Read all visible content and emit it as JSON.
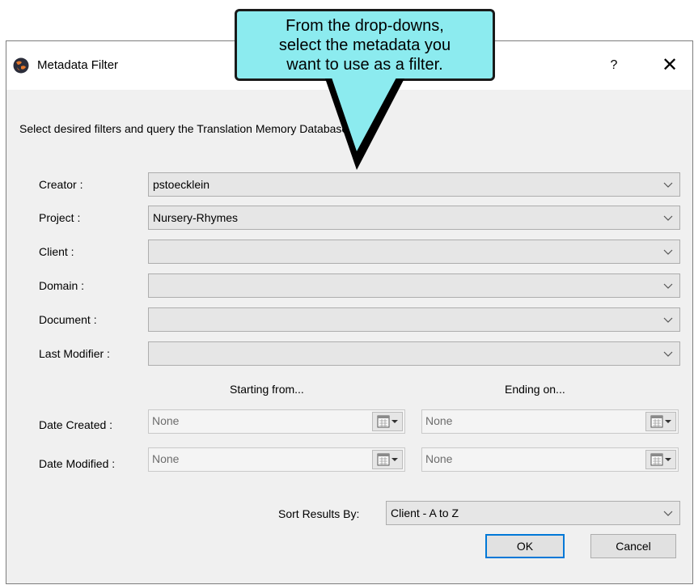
{
  "window": {
    "title": "Metadata Filter",
    "help": "?",
    "close": "✕"
  },
  "callout": {
    "text": "From the drop-downs,\nselect the metadata you\nwant to use as a filter."
  },
  "intro": "Select desired filters and query the Translation Memory Database...",
  "filters": [
    {
      "label": "Creator :",
      "value": "pstoecklein"
    },
    {
      "label": "Project :",
      "value": "Nursery-Rhymes"
    },
    {
      "label": "Client :",
      "value": ""
    },
    {
      "label": "Domain :",
      "value": ""
    },
    {
      "label": "Document :",
      "value": ""
    },
    {
      "label": "Last Modifier :",
      "value": ""
    }
  ],
  "dates": {
    "start_header": "Starting from...",
    "end_header": "Ending on...",
    "created": {
      "label": "Date Created :",
      "start": "None",
      "end": "None"
    },
    "modified": {
      "label": "Date Modified :",
      "start": "None",
      "end": "None"
    }
  },
  "sort": {
    "label": "Sort Results By:",
    "value": "Client - A to Z"
  },
  "buttons": {
    "ok": "OK",
    "cancel": "Cancel"
  },
  "colors": {
    "callout_fill": "#8cebef",
    "default_button_border": "#0078d7",
    "dialog_background": "#f0f0f0"
  }
}
